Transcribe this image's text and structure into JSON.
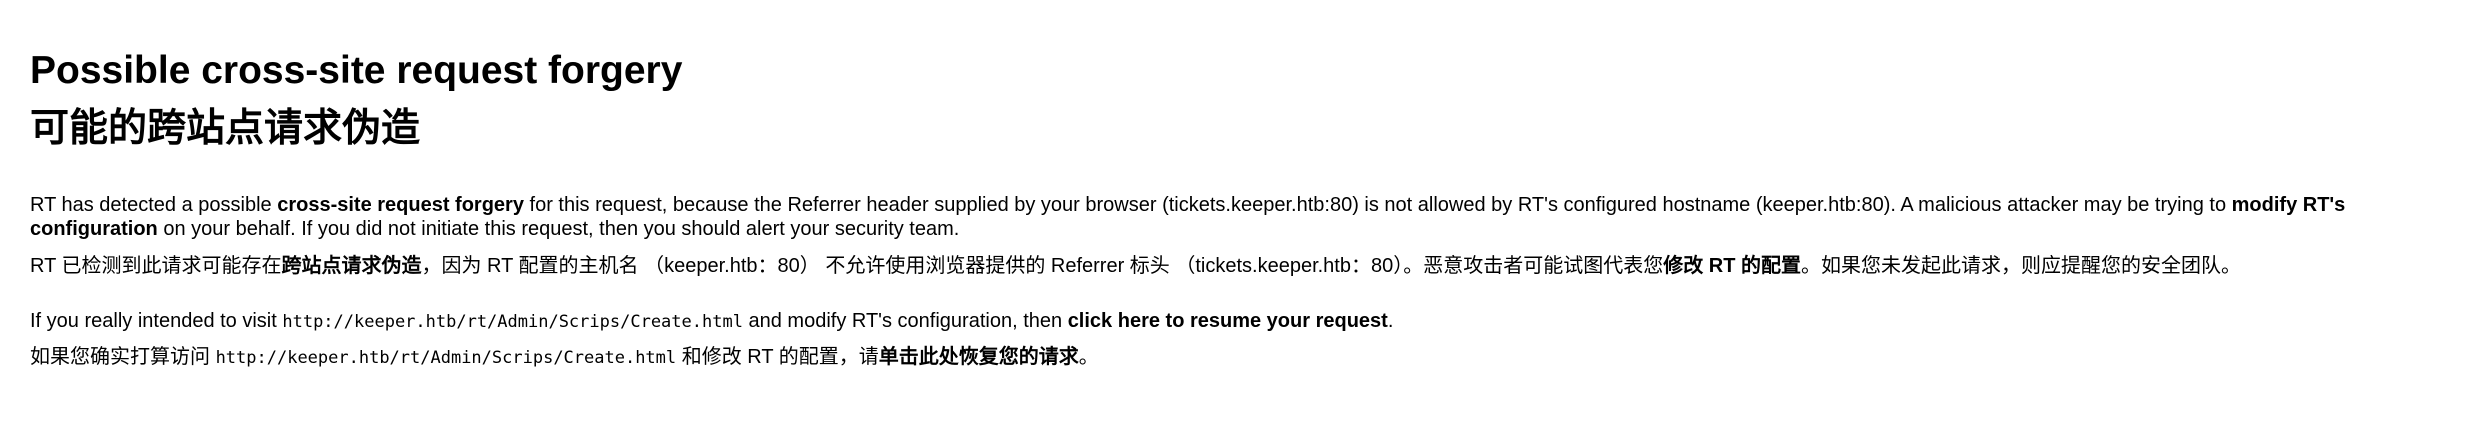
{
  "title_en": "Possible cross-site request forgery",
  "title_zh": "可能的跨站点请求伪造",
  "p1": {
    "s1": "RT has detected a possible ",
    "b1": "cross-site request forgery",
    "s2": " for this request, because the Referrer header supplied by your browser (tickets.keeper.htb:80) is not allowed by RT's configured hostname (keeper.htb:80). A malicious attacker may be trying to ",
    "b2": "modify RT's configuration",
    "s3": " on your behalf. If you did not initiate this request, then you should alert your security team."
  },
  "p1_zh": {
    "s1": "RT 已检测到此请求可能存在",
    "b1": "跨站点请求伪造",
    "s2": "，因为 RT 配置的主机名 （keeper.htb：80） 不允许使用浏览器提供的 Referrer 标头 （tickets.keeper.htb：80）。恶意攻击者可能试图代表您",
    "b2": "修改 RT 的配置",
    "s3": "。如果您未发起此请求，则应提醒您的安全团队。"
  },
  "p2": {
    "s1": "If you really intended to visit ",
    "url": "http://keeper.htb/rt/Admin/Scrips/Create.html",
    "s2": " and modify RT's configuration, then ",
    "link": "click here to resume your request",
    "s3": "."
  },
  "p2_zh": {
    "s1": "如果您确实打算访问 ",
    "url": "http://keeper.htb/rt/Admin/Scrips/Create.html",
    "s2": " 和修改 RT 的配置，请",
    "link": "单击此处恢复您的请求",
    "s3": "。"
  }
}
